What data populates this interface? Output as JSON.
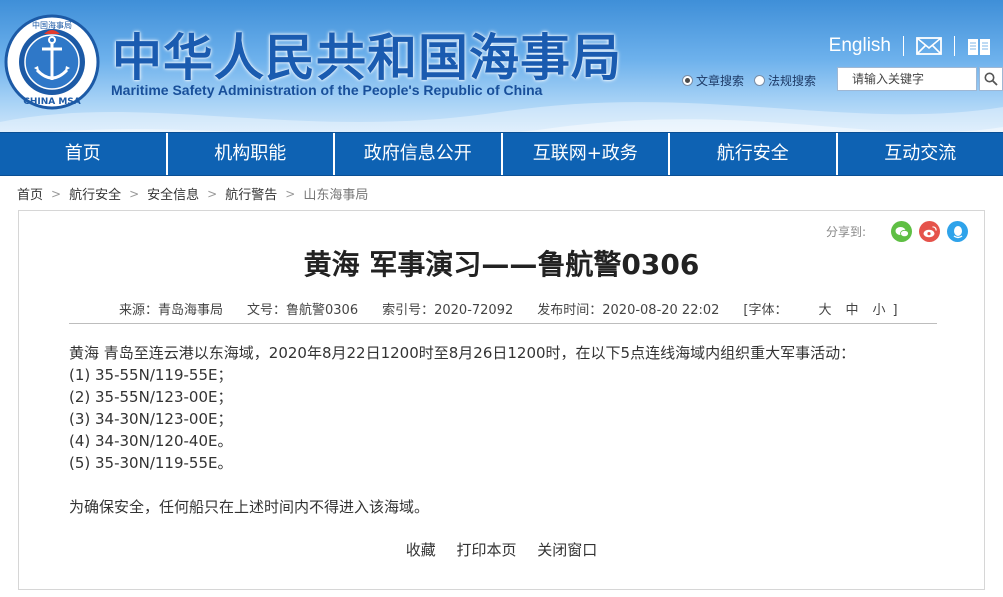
{
  "header": {
    "logo_text_top": "中国海事局",
    "logo_text_bottom": "CHINA MSA",
    "title": "中华人民共和国海事局",
    "subtitle": "Maritime Safety Administration of the People's Republic of China",
    "english_link": "English",
    "radio_article": "文章搜索",
    "radio_regulation": "法规搜索",
    "search_placeholder": "请输入关键字"
  },
  "nav": [
    "首页",
    "机构职能",
    "政府信息公开",
    "互联网+政务",
    "航行安全",
    "互动交流"
  ],
  "breadcrumb": [
    "首页",
    "航行安全",
    "安全信息",
    "航行警告",
    "山东海事局"
  ],
  "share_label": "分享到:",
  "article": {
    "title": "黄海 军事演习——鲁航警0306",
    "source": "来源：青岛海事局",
    "doc_no": "文号：鲁航警0306",
    "index_no": "索引号：2020-72092",
    "publish_time": "发布时间：2020-08-20 22:02",
    "font_label_open": "[字体：",
    "font_large": "大",
    "font_medium": "中",
    "font_small": "小",
    "font_label_close": "]",
    "paragraph1": "黄海  青岛至连云港以东海域，2020年8月22日1200时至8月26日1200时，在以下5点连线海域内组织重大军事活动：",
    "points": [
      "(1) 35-55N/119-55E；",
      "(2) 35-55N/123-00E；",
      "(3) 34-30N/123-00E；",
      "(4) 34-30N/120-40E。",
      "(5) 35-30N/119-55E。"
    ],
    "paragraph2": "为确保安全，任何船只在上述时间内不得进入该海域。"
  },
  "actions": {
    "favorite": "收藏",
    "print": "打印本页",
    "close": "关闭窗口"
  },
  "colors": {
    "nav_bg": "#0e62b3",
    "title_blue": "#1a5bb0",
    "wechat": "#5fbf44",
    "weibo": "#e5534b",
    "qq": "#2fa3ea"
  }
}
